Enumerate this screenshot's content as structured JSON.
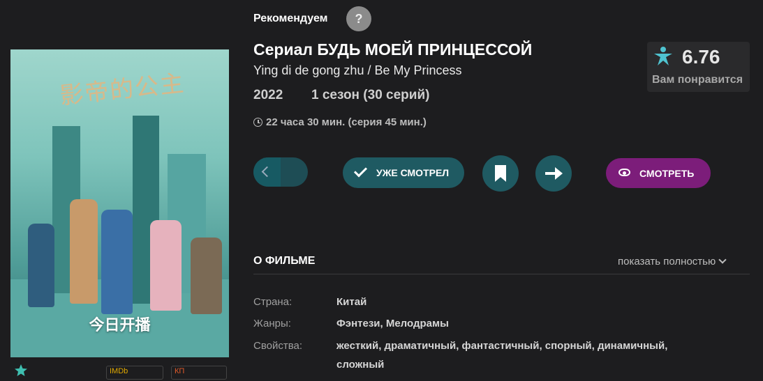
{
  "header": {
    "recommend_label": "Рекомендуем",
    "help_icon": "?"
  },
  "title": {
    "main": "Сериал БУДЬ МОЕЙ ПРИНЦЕССОЙ",
    "original": "Ying di de gong zhu / Be My Princess",
    "year": "2022",
    "season": "1 сезон (30 серий)",
    "duration": "22 часа 30 мин. (серия 45 мин.)"
  },
  "rating": {
    "value": "6.76",
    "caption": "Вам понравится",
    "icon": "person-star-icon",
    "color": "#4fc3d0"
  },
  "poster": {
    "art_title": "影帝的公主",
    "caption": "今日开播"
  },
  "below_poster": {
    "imdb_label": "IMDb",
    "kp_label": "КП"
  },
  "actions": {
    "watched_label": "УЖЕ СМОТРЕЛ",
    "watch_label": "СМОТРЕТЬ",
    "watch_color": "#7c1d7a",
    "teal_color": "#1f5a62"
  },
  "about": {
    "heading": "О ФИЛЬМЕ",
    "show_full": "показать полностью",
    "rows": [
      {
        "key": "Страна:",
        "value": "Китай"
      },
      {
        "key": "Жанры:",
        "value": "Фэнтези,  Мелодрамы"
      },
      {
        "key": "Свойства:",
        "value": "жесткий,  драматичный,  фантастичный,  спорный,  динамичный,",
        "value2": "сложный"
      }
    ]
  }
}
